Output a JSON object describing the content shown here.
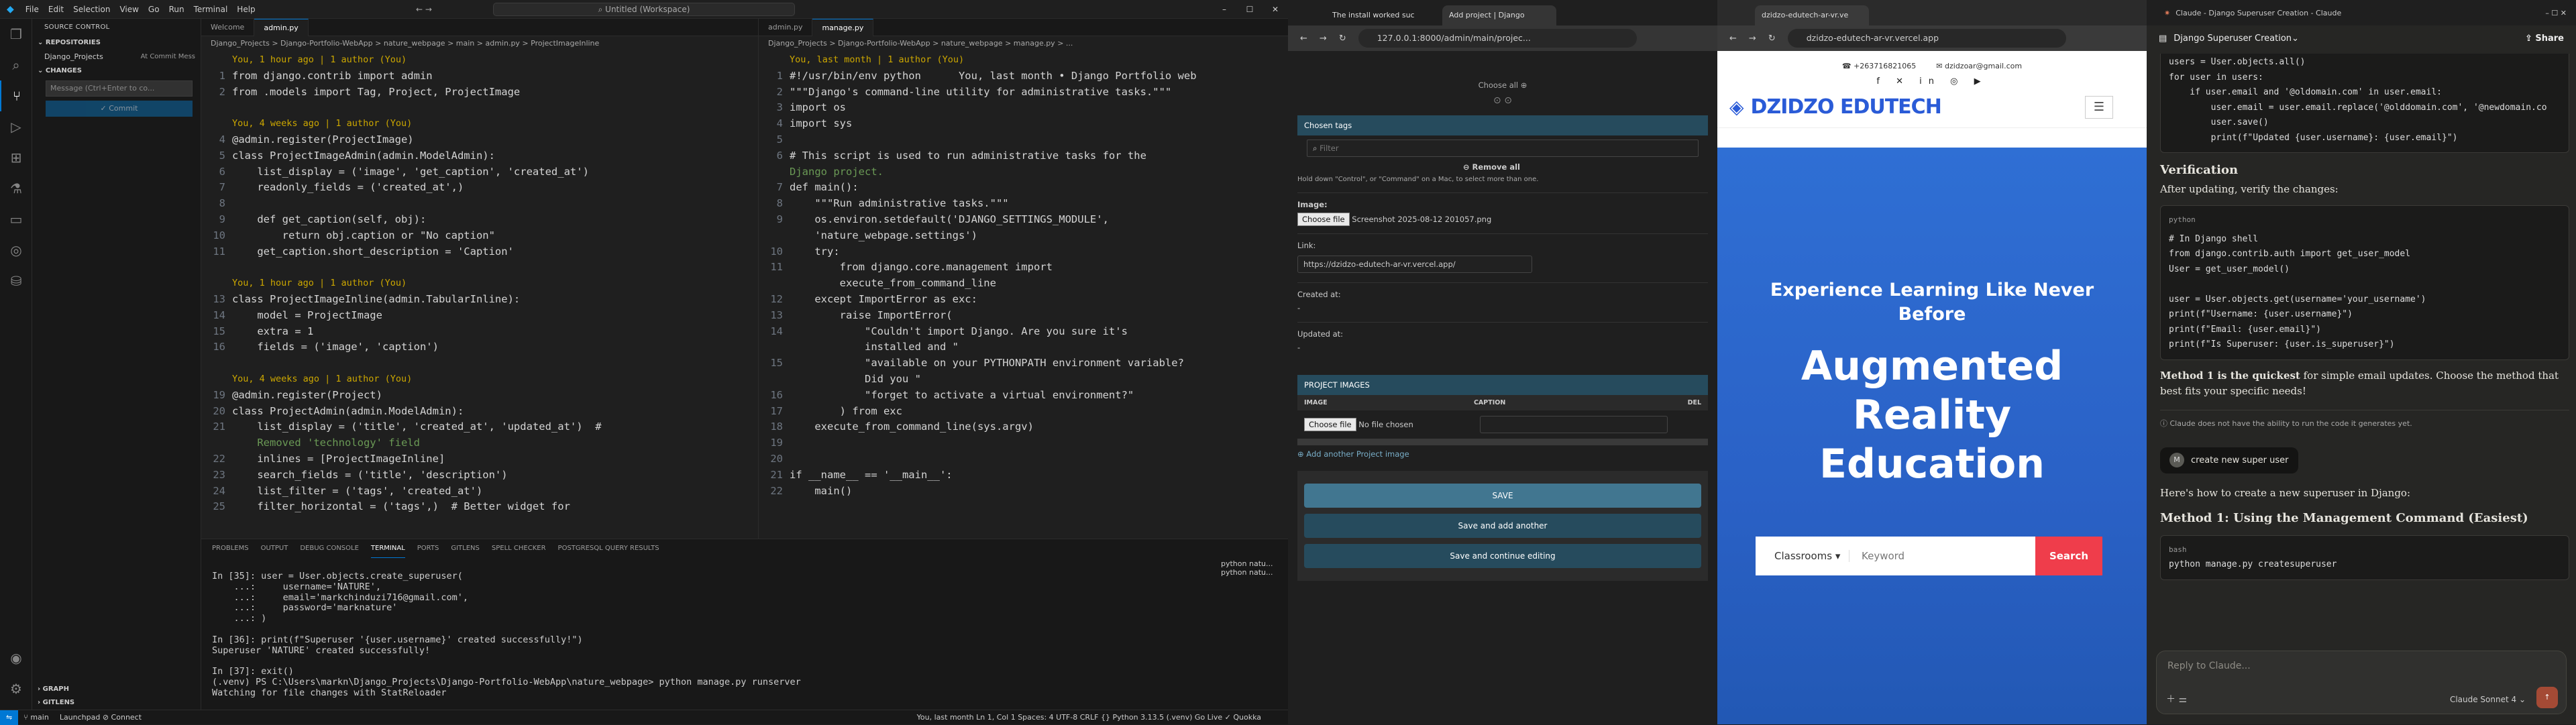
{
  "vscode": {
    "menu": [
      "File",
      "Edit",
      "Selection",
      "View",
      "Go",
      "Run",
      "Terminal",
      "Help"
    ],
    "search": "Untitled (Workspace)",
    "sidebar": {
      "title": "SOURCE CONTROL",
      "repos": "REPOSITORIES",
      "repo_name": "Django_Projects",
      "repo_branch": "At Commit Mess",
      "changes": "CHANGES",
      "commit_placeholder": "Message (Ctrl+Enter to co...",
      "commit_btn": "✓ Commit",
      "graph": "GRAPH",
      "gitlens": "GITLENS"
    },
    "editor1": {
      "tabs": [
        "Welcome",
        "admin.py"
      ],
      "crumb": "Django_Projects > Django-Portfolio-WebApp > nature_webpage > main > admin.py > ProjectImageInline",
      "lines": [
        {
          "n": "",
          "t": "You, 1 hour ago | 1 author (You)",
          "c": "blame"
        },
        {
          "n": "1",
          "t": "from django.contrib import admin"
        },
        {
          "n": "2",
          "t": "from .models import Tag, Project, ProjectImage"
        },
        {
          "n": "",
          "t": ""
        },
        {
          "n": "",
          "t": "You, 4 weeks ago | 1 author (You)",
          "c": "blame"
        },
        {
          "n": "4",
          "t": "@admin.register(ProjectImage)"
        },
        {
          "n": "5",
          "t": "class ProjectImageAdmin(admin.ModelAdmin):"
        },
        {
          "n": "6",
          "t": "    list_display = ('image', 'get_caption', 'created_at')"
        },
        {
          "n": "7",
          "t": "    readonly_fields = ('created_at',)"
        },
        {
          "n": "8",
          "t": ""
        },
        {
          "n": "9",
          "t": "    def get_caption(self, obj):"
        },
        {
          "n": "10",
          "t": "        return obj.caption or \"No caption\""
        },
        {
          "n": "11",
          "t": "    get_caption.short_description = 'Caption'"
        },
        {
          "n": "",
          "t": ""
        },
        {
          "n": "",
          "t": "You, 1 hour ago | 1 author (You)",
          "c": "blame"
        },
        {
          "n": "13",
          "t": "class ProjectImageInline(admin.TabularInline):"
        },
        {
          "n": "14",
          "t": "    model = ProjectImage"
        },
        {
          "n": "15",
          "t": "    extra = 1"
        },
        {
          "n": "16",
          "t": "    fields = ('image', 'caption')"
        },
        {
          "n": "",
          "t": ""
        },
        {
          "n": "",
          "t": "You, 4 weeks ago | 1 author (You)",
          "c": "blame"
        },
        {
          "n": "19",
          "t": "@admin.register(Project)"
        },
        {
          "n": "20",
          "t": "class ProjectAdmin(admin.ModelAdmin):"
        },
        {
          "n": "21",
          "t": "    list_display = ('title', 'created_at', 'updated_at')  #"
        },
        {
          "n": "",
          "t": "    Removed 'technology' field",
          "c": "cm"
        },
        {
          "n": "22",
          "t": "    inlines = [ProjectImageInline]"
        },
        {
          "n": "23",
          "t": "    search_fields = ('title', 'description')"
        },
        {
          "n": "24",
          "t": "    list_filter = ('tags', 'created_at')"
        },
        {
          "n": "25",
          "t": "    filter_horizontal = ('tags',)  # Better widget for"
        }
      ]
    },
    "editor2": {
      "tabs": [
        "admin.py",
        "manage.py"
      ],
      "crumb": "Django_Projects > Django-Portfolio-WebApp > nature_webpage > manage.py > ...",
      "lines": [
        {
          "n": "",
          "t": "You, last month | 1 author (You)",
          "c": "blame"
        },
        {
          "n": "1",
          "t": "#!/usr/bin/env python      You, last month • Django Portfolio web"
        },
        {
          "n": "2",
          "t": "\"\"\"Django's command-line utility for administrative tasks.\"\"\""
        },
        {
          "n": "3",
          "t": "import os"
        },
        {
          "n": "4",
          "t": "import sys"
        },
        {
          "n": "5",
          "t": ""
        },
        {
          "n": "6",
          "t": "# This script is used to run administrative tasks for the"
        },
        {
          "n": "",
          "t": "Django project.",
          "c": "cm"
        },
        {
          "n": "7",
          "t": "def main():"
        },
        {
          "n": "8",
          "t": "    \"\"\"Run administrative tasks.\"\"\""
        },
        {
          "n": "9",
          "t": "    os.environ.setdefault('DJANGO_SETTINGS_MODULE',"
        },
        {
          "n": "",
          "t": "    'nature_webpage.settings')"
        },
        {
          "n": "10",
          "t": "    try:"
        },
        {
          "n": "11",
          "t": "        from django.core.management import"
        },
        {
          "n": "",
          "t": "        execute_from_command_line"
        },
        {
          "n": "12",
          "t": "    except ImportError as exc:"
        },
        {
          "n": "13",
          "t": "        raise ImportError("
        },
        {
          "n": "14",
          "t": "            \"Couldn't import Django. Are you sure it's"
        },
        {
          "n": "",
          "t": "            installed and \""
        },
        {
          "n": "15",
          "t": "            \"available on your PYTHONPATH environment variable?"
        },
        {
          "n": "",
          "t": "            Did you \""
        },
        {
          "n": "16",
          "t": "            \"forget to activate a virtual environment?\""
        },
        {
          "n": "17",
          "t": "        ) from exc"
        },
        {
          "n": "18",
          "t": "    execute_from_command_line(sys.argv)"
        },
        {
          "n": "19",
          "t": ""
        },
        {
          "n": "20",
          "t": ""
        },
        {
          "n": "21",
          "t": "if __name__ == '__main__':"
        },
        {
          "n": "22",
          "t": "    main()"
        }
      ]
    },
    "panel": {
      "tabs": [
        "PROBLEMS",
        "OUTPUT",
        "DEBUG CONSOLE",
        "TERMINAL",
        "PORTS",
        "GITLENS",
        "SPELL CHECKER",
        "POSTGRESQL QUERY RESULTS"
      ],
      "term": "In [35]: user = User.objects.create_superuser(\n    ...:     username='NATURE',\n    ...:     email='markchinduzi716@gmail.com',\n    ...:     password='marknature'\n    ...: )\n\nIn [36]: print(f\"Superuser '{user.username}' created successfully!\")\nSuperuser 'NATURE' created successfully!\n\nIn [37]: exit()\n(.venv) PS C:\\Users\\markn\\Django_Projects\\Django-Portfolio-WebApp\\nature_webpage> python manage.py runserver\nWatching for file changes with StatReloader",
      "terms": [
        "python  natu...",
        "python  natu..."
      ]
    },
    "status": {
      "branch": "main",
      "items": "Launchpad  ⊘ Connect",
      "right": "You, last month   Ln 1, Col 1   Spaces: 4   UTF-8   CRLF   {} Python   3.13.5 (.venv)   Go Live   ✓ Quokka"
    }
  },
  "browser1": {
    "tabs": [
      "The install worked suc",
      "Add project | Django"
    ],
    "url": "127.0.0.1:8000/admin/main/projec...",
    "choose_all": "Choose all ⊕",
    "chosen_tags": "Chosen tags",
    "filter_ph": "Filter",
    "remove_all": "⊖ Remove all",
    "hold_note": "Hold down \"Control\", or \"Command\" on a Mac, to select more than one.",
    "image_label": "Image:",
    "choose_file": "Choose file",
    "file_name": "Screenshot 2025-08-12 201057.png",
    "link_label": "Link:",
    "link_value": "https://dzidzo-edutech-ar-vr.vercel.app/",
    "created_label": "Created at:",
    "created_val": "-",
    "updated_label": "Updated at:",
    "updated_val": "-",
    "project_images": "PROJECT IMAGES",
    "col_image": "IMAGE",
    "col_caption": "CAPTION",
    "col_del": "DEL",
    "no_file": "No file chosen",
    "add_another": "⊕ Add another Project image",
    "save": "SAVE",
    "save_add": "Save and add another",
    "save_cont": "Save and continue editing"
  },
  "browser2": {
    "tabs": [
      "dzidzo-edutech-ar-vr.ve"
    ],
    "url": "dzidzo-edutech-ar-vr.vercel.app",
    "phone": "+263716821065",
    "email": "dzidzoar@gmail.com",
    "logo": "DZIDZO EDUTECH",
    "tagline": "Experience Learning Like Never Before",
    "headline": "Augmented Reality Education",
    "select": "Classrooms",
    "keyword": "Keyword",
    "search": "Search"
  },
  "browser3": {
    "tab": "Claude - Django Superuser Creation - Claude",
    "chat_title": "Django Superuser Creation",
    "share": "Share",
    "code_top": [
      "users = User.objects.all()",
      "for user in users:",
      "    if user.email and '@oldomain.com' in user.email:",
      "        user.email = user.email.replace('@olddomain.com', '@newdomain.co",
      "        user.save()",
      "        print(f\"Updated {user.username}: {user.email}\")"
    ],
    "verif_h": "Verification",
    "verif_p": "After updating, verify the changes:",
    "code_lang": "python",
    "code2": [
      "# In Django shell",
      "from django.contrib.auth import get_user_model",
      "User = get_user_model()",
      "",
      "user = User.objects.get(username='your_username')",
      "print(f\"Username: {user.username}\")",
      "print(f\"Email: {user.email}\")",
      "print(f\"Is Superuser: {user.is_superuser}\")"
    ],
    "method_note_b": "Method 1 is the quickest",
    "method_note": " for simple email updates. Choose the method that best fits your specific needs!",
    "disclaimer": "Claude does not have the ability to run the code it generates yet.",
    "user_msg": "create new super user",
    "reply_intro": "Here's how to create a new superuser in Django:",
    "reply_h": "Method 1: Using the Management Command (Easiest)",
    "code3_lang": "bash",
    "code3": "python manage.py createsuperuser",
    "reply_ph": "Reply to Claude...",
    "model": "Claude Sonnet 4 ⌄"
  }
}
